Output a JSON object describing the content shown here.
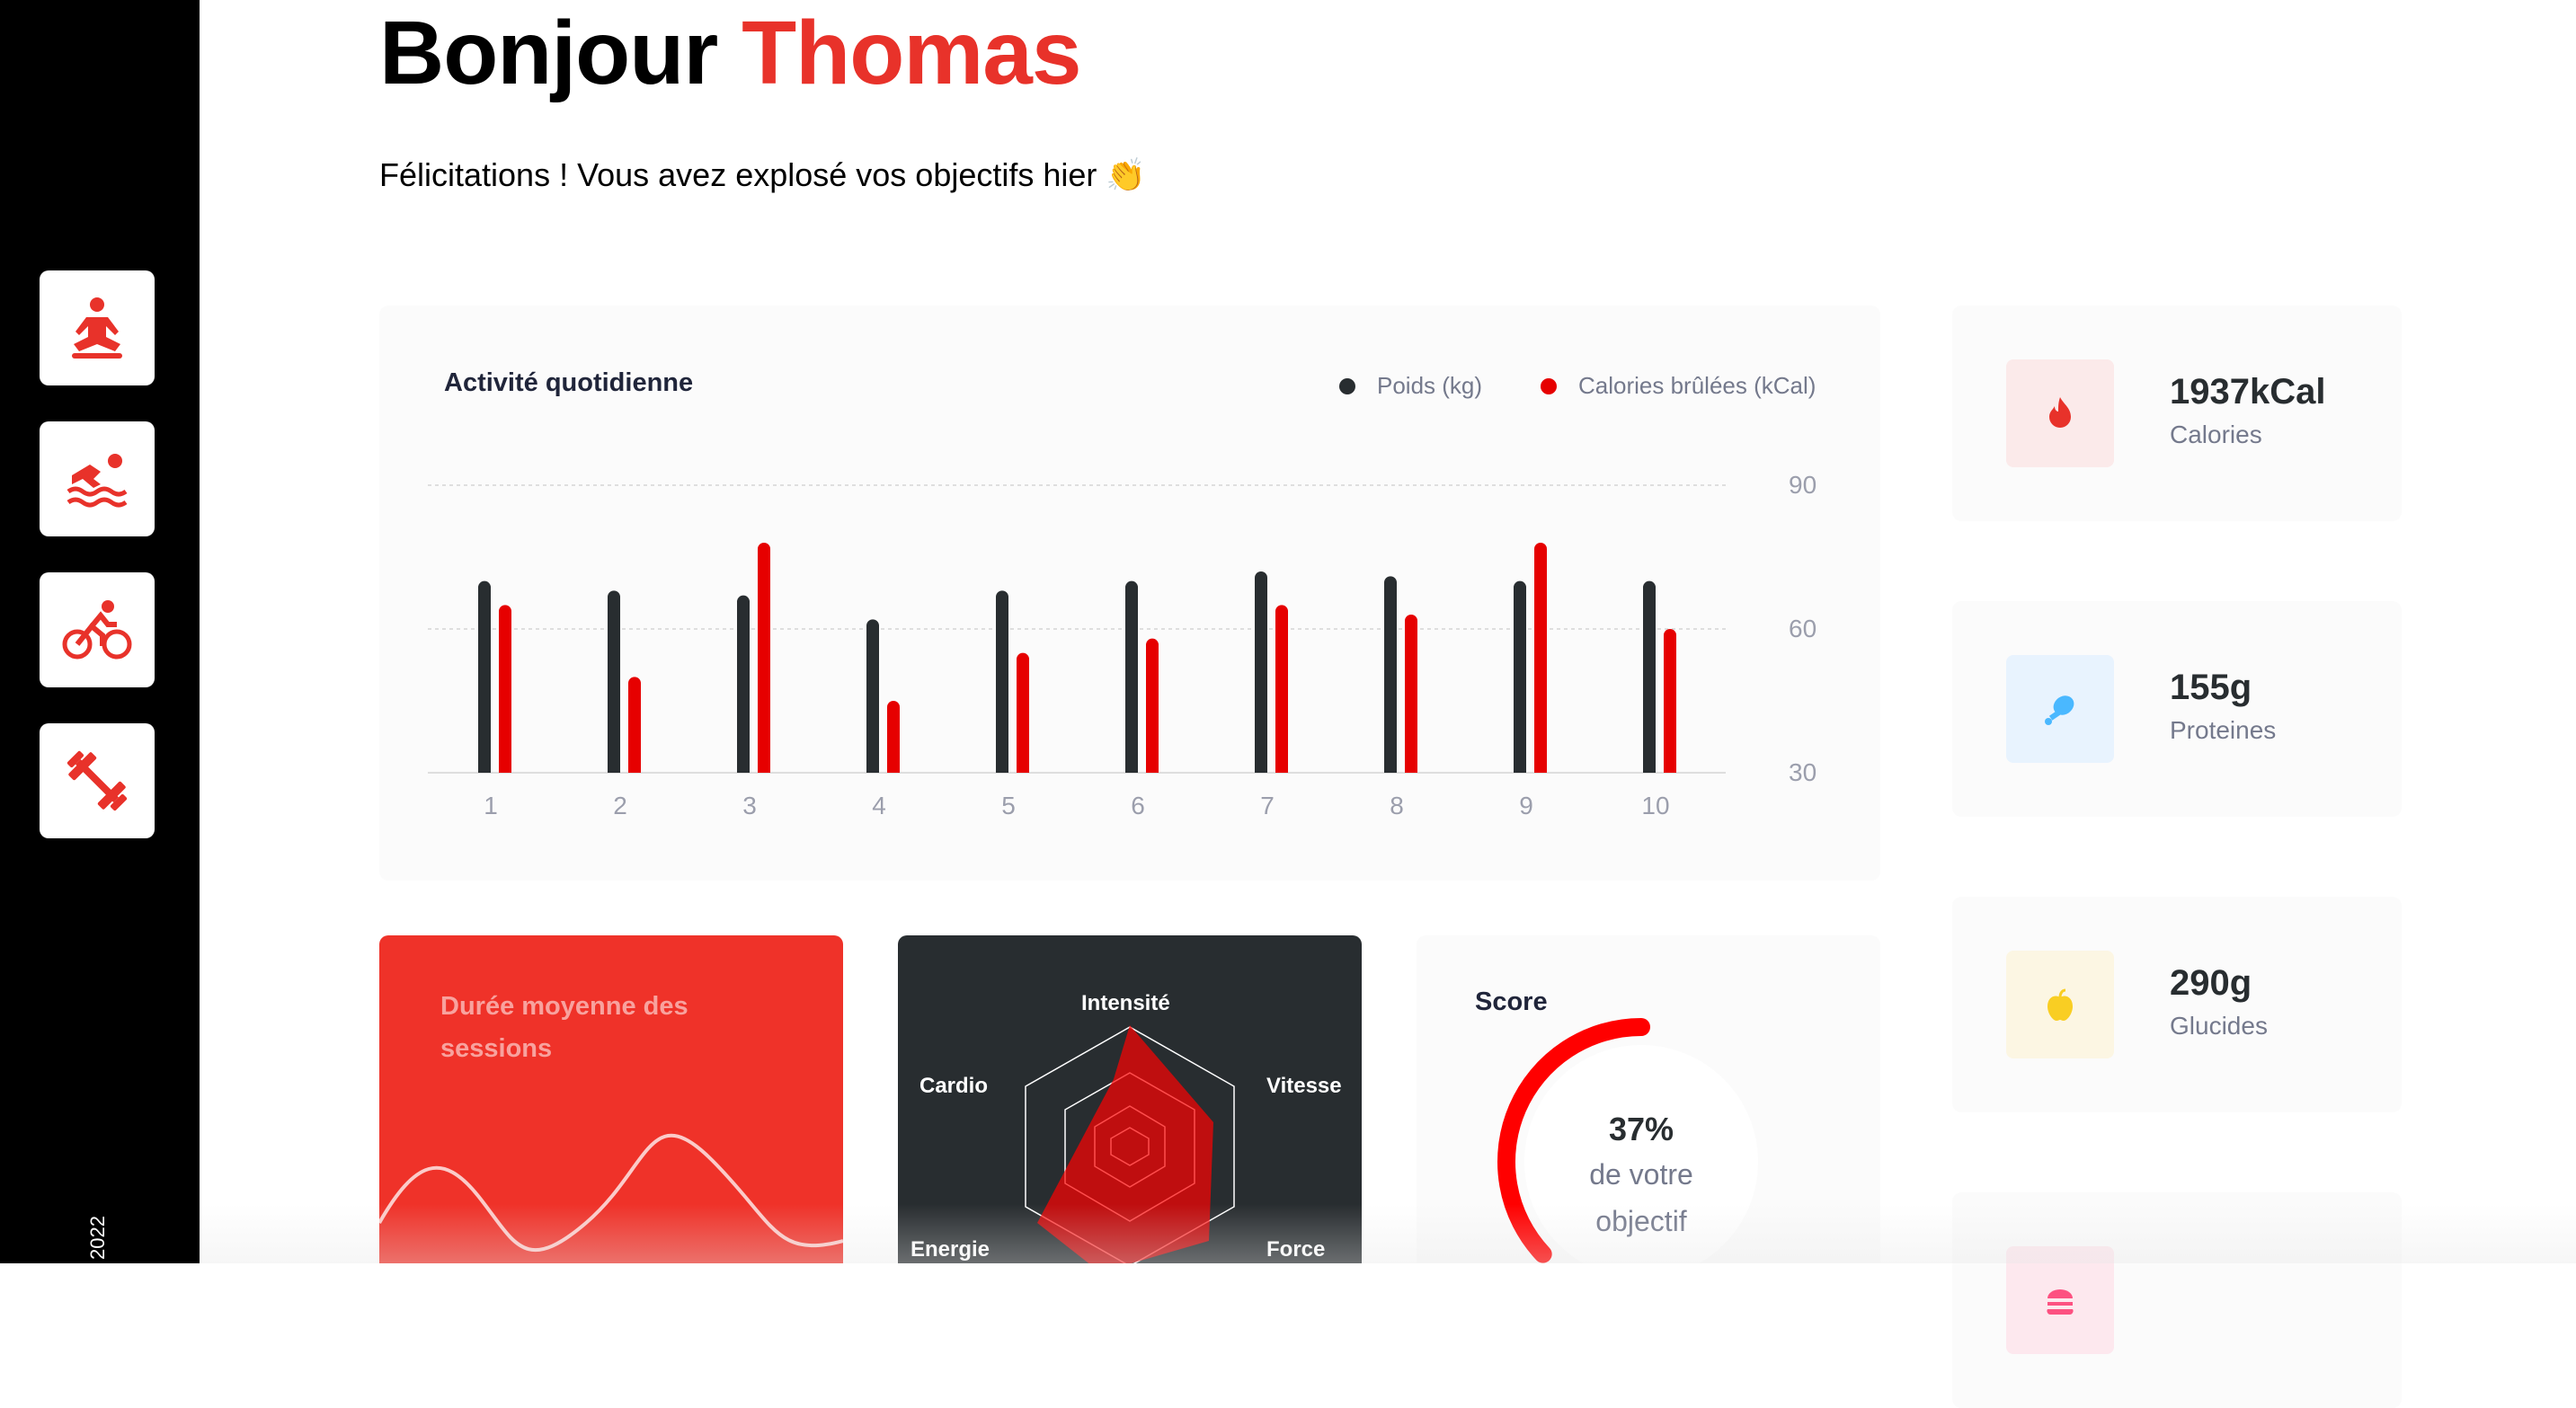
{
  "sidebar": {
    "items": [
      {
        "icon": "yoga-icon"
      },
      {
        "icon": "swimming-icon"
      },
      {
        "icon": "cycling-icon"
      },
      {
        "icon": "dumbbell-icon"
      }
    ],
    "copyright": "2022"
  },
  "header": {
    "greeting": "Bonjour",
    "name": "Thomas",
    "subtitle": "Félicitations ! Vous avez explosé vos objectifs hier 👏"
  },
  "activity": {
    "title": "Activité quotidienne",
    "legend": {
      "weight": "Poids (kg)",
      "calories": "Calories brûlées (kCal)"
    }
  },
  "colors": {
    "accent": "#e8322a",
    "black": "#282d30",
    "red": "#e60000"
  },
  "chart_data": {
    "type": "bar",
    "title": "Activité quotidienne",
    "categories": [
      "1",
      "2",
      "3",
      "4",
      "5",
      "6",
      "7",
      "8",
      "9",
      "10"
    ],
    "series": [
      {
        "name": "Poids (kg)",
        "values": [
          70,
          68,
          67,
          62,
          68,
          70,
          72,
          71,
          70,
          70
        ]
      },
      {
        "name": "Calories brûlées (kCal)",
        "values": [
          65,
          50,
          78,
          45,
          55,
          58,
          65,
          63,
          78,
          60
        ]
      }
    ],
    "y_ticks": [
      "90",
      "60",
      "30"
    ],
    "ylim": [
      30,
      90
    ],
    "axis_position": "right",
    "grid": true,
    "legend_position": "top-right"
  },
  "average_sessions": {
    "title": "Durée moyenne des sessions"
  },
  "performance": {
    "labels": [
      "Intensité",
      "Vitesse",
      "Force",
      "Energie",
      "Cardio"
    ],
    "values": {
      "Intensité": 1.0,
      "Vitesse": 0.7,
      "Force": 0.62,
      "Energie": 0.55,
      "Cardio": 0.1
    }
  },
  "score": {
    "title": "Score",
    "value": 0.37,
    "percent": "37%",
    "line1": "de votre",
    "line2": "objectif"
  },
  "nutrition": [
    {
      "value": "1937kCal",
      "label": "Calories",
      "icon": "flame-icon",
      "color": "#e8322a",
      "bg": "#fbeaea"
    },
    {
      "value": "155g",
      "label": "Proteines",
      "icon": "chicken-leg-icon",
      "color": "#4ab8ff",
      "bg": "#e8f3fe"
    },
    {
      "value": "290g",
      "label": "Glucides",
      "icon": "apple-icon",
      "color": "#f9ce23",
      "bg": "#fcf6e3"
    },
    {
      "value": "",
      "label": "",
      "icon": "burger-icon",
      "color": "#fd5181",
      "bg": "#fde8ee"
    }
  ]
}
